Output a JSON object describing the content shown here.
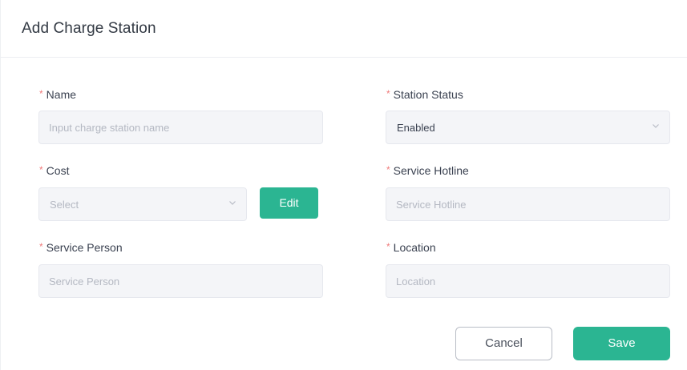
{
  "dialog": {
    "title": "Add Charge Station"
  },
  "form": {
    "required_mark": "*",
    "name": {
      "label": "Name",
      "placeholder": "Input charge station name",
      "value": ""
    },
    "station_status": {
      "label": "Station Status",
      "selected": "Enabled",
      "icon": "chevron-down-icon"
    },
    "cost": {
      "label": "Cost",
      "placeholder": "Select",
      "icon": "chevron-down-icon",
      "edit_label": "Edit"
    },
    "service_hotline": {
      "label": "Service Hotline",
      "placeholder": "Service Hotline",
      "value": ""
    },
    "service_person": {
      "label": "Service Person",
      "placeholder": "Service Person",
      "value": ""
    },
    "location": {
      "label": "Location",
      "placeholder": "Location",
      "value": ""
    }
  },
  "actions": {
    "cancel_label": "Cancel",
    "save_label": "Save"
  },
  "colors": {
    "accent": "#2bb592",
    "required": "#f07a7a",
    "input_bg": "#f4f5f8"
  }
}
